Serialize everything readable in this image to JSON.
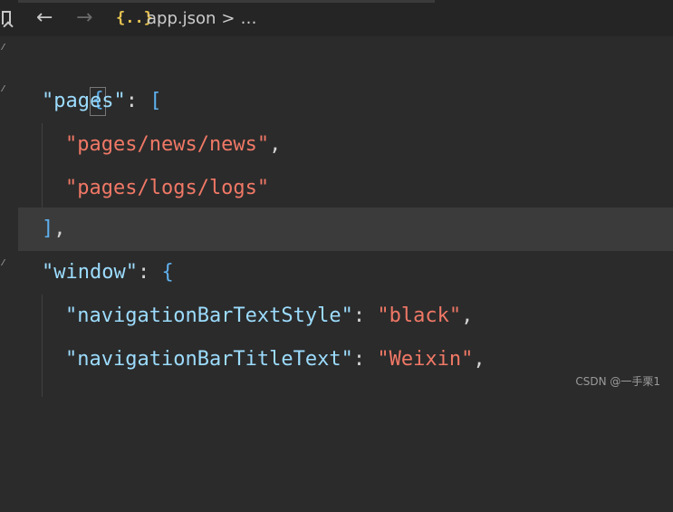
{
  "toolbar": {
    "back_icon": "←",
    "forward_icon": "→",
    "file_icon": "{..}",
    "filename": "app.json",
    "separator": ">",
    "more": "…"
  },
  "code": {
    "line1": {
      "brace": "{"
    },
    "line2": {
      "key": "\"pages\"",
      "colon": ":",
      "bracket": "["
    },
    "line3": {
      "str": "\"pages/news/news\"",
      "comma": ","
    },
    "line4": {
      "str": "\"pages/logs/logs\""
    },
    "line5": {
      "bracket": "]",
      "comma": ","
    },
    "line6": {
      "key": "\"window\"",
      "colon": ":",
      "brace": "{"
    },
    "line7": {
      "key": "\"navigationBarTextStyle\"",
      "colon": ":",
      "value": "\"black\"",
      "comma": ","
    },
    "line8": {
      "key": "\"navigationBarTitleText\"",
      "colon": ":",
      "value": "\"Weixin\"",
      "comma": ","
    }
  },
  "watermark": "CSDN @一手栗1",
  "colors": {
    "background": "#2b2b2b",
    "key": "#9cdcfe",
    "string": "#f07866",
    "bracket": "#5fb0ee",
    "current_line": "#3b3b3b"
  }
}
